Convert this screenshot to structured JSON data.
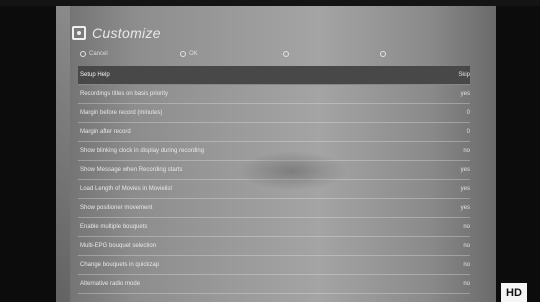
{
  "window": {
    "title": "Customize"
  },
  "buttons": [
    {
      "label": "Cancel"
    },
    {
      "label": "OK"
    },
    {
      "label": ""
    },
    {
      "label": ""
    }
  ],
  "menu": {
    "items": [
      {
        "label": "Setup Help",
        "value": "Skip",
        "selected": true
      },
      {
        "label": "Recordings titles on basis priority",
        "value": "yes",
        "selected": false
      },
      {
        "label": "Margin before record (minutes)",
        "value": "0",
        "selected": false
      },
      {
        "label": "Margin after record",
        "value": "0",
        "selected": false
      },
      {
        "label": "Show blinking clock in display during recording",
        "value": "no",
        "selected": false
      },
      {
        "label": "Show Message when Recording starts",
        "value": "yes",
        "selected": false
      },
      {
        "label": "Load Length of Movies in Movielist",
        "value": "yes",
        "selected": false
      },
      {
        "label": "Show positioner movement",
        "value": "yes",
        "selected": false
      },
      {
        "label": "Enable multiple bouquets",
        "value": "no",
        "selected": false
      },
      {
        "label": "Multi-EPG bouquet selection",
        "value": "no",
        "selected": false
      },
      {
        "label": "Change bouquets in quickzap",
        "value": "no",
        "selected": false
      },
      {
        "label": "Alternative radio mode",
        "value": "no",
        "selected": false
      }
    ]
  },
  "badge": {
    "label": "HD"
  },
  "colors": {
    "selected_row": "#484848",
    "text": "#e8e8e8"
  }
}
